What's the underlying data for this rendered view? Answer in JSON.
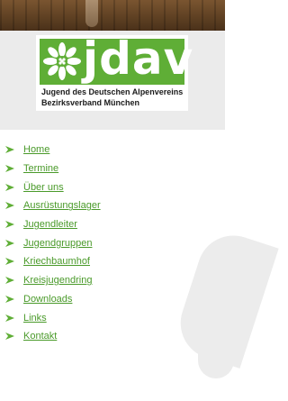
{
  "logo": {
    "wordmark": "jdav",
    "line1": "Jugend des Deutschen Alpenvereins",
    "line2": "Bezirksverband München"
  },
  "colors": {
    "brand_green": "#5fae36",
    "link_green": "#4a9a2a"
  },
  "nav": {
    "items": [
      {
        "label": "Home"
      },
      {
        "label": "Termine"
      },
      {
        "label": "Über uns"
      },
      {
        "label": "Ausrüstungslager"
      },
      {
        "label": "Jugendleiter"
      },
      {
        "label": "Jugendgruppen"
      },
      {
        "label": "Kriechbaumhof"
      },
      {
        "label": "Kreisjugendring"
      },
      {
        "label": "Downloads"
      },
      {
        "label": "Links"
      },
      {
        "label": "Kontakt"
      }
    ]
  }
}
